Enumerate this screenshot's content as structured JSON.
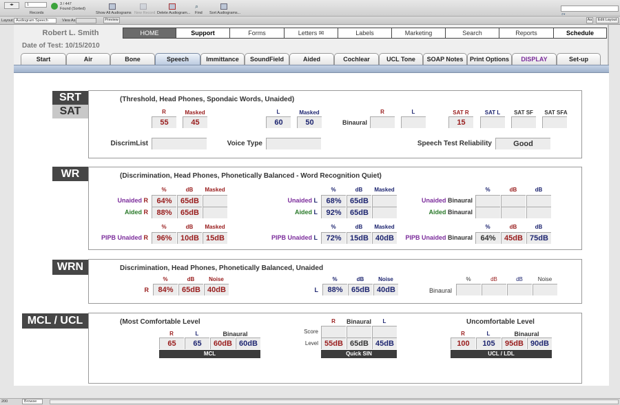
{
  "toolbar": {
    "record_number": "1",
    "records_label": "Records",
    "found_count": "3 / 447",
    "found_label": "Found (Sorted)",
    "show_all": "Show All Audiograms",
    "new_record": "New Record",
    "delete": "Delete Audiogram...",
    "find": "Find",
    "sort": "Sort Audiograms...",
    "search_placeholder": ""
  },
  "layout_bar": {
    "layout_label": "Layout:",
    "layout_value": "Audiogram Speech",
    "view_as": "View As:",
    "preview": "Preview",
    "aa": "Aа",
    "edit_layout": "Edit Layout"
  },
  "patient": {
    "name": "Robert L. Smith",
    "date": "Date of Test: 10/15/2010"
  },
  "nav": [
    "HOME",
    "Support",
    "Forms",
    "Letters",
    "Labels",
    "Marketing",
    "Search",
    "Reports",
    "Schedule"
  ],
  "tabs": [
    "Start",
    "Air",
    "Bone",
    "Speech",
    "Immittance",
    "SoundField",
    "Aided",
    "Cochlear",
    "UCL Tone",
    "SOAP Notes",
    "Print Options",
    "DISPLAY",
    "Set-up"
  ],
  "active_tab": "Speech",
  "colors": {
    "right": "#981b1b",
    "left": "#1d2570",
    "unaided": "#7b2c9b",
    "aided": "#2b7a2b",
    "active_nav": "#6b6b6b"
  },
  "srt": {
    "title1": "SRT",
    "title2": "SAT",
    "subtitle": "(Threshold, Head Phones, Spondaic Words, Unaided)",
    "h": {
      "r": "R",
      "masked": "Masked",
      "l": "L",
      "bin_r": "R",
      "bin_l": "L",
      "sat_r": "SAT R",
      "sat_l": "SAT L",
      "sat_sf": "SAT SF",
      "sat_sfa": "SAT SFA"
    },
    "v": {
      "r": "55",
      "r_masked": "45",
      "l": "60",
      "l_masked": "50",
      "bin_r": "",
      "bin_l": "",
      "sat_r": "15",
      "sat_l": "",
      "sat_sf": "",
      "sat_sfa": ""
    },
    "binaural": "Binaural",
    "discrim_label": "DiscrimList",
    "discrim": "",
    "voice_label": "Voice Type",
    "voice": "",
    "reliability_label": "Speech Test Reliability",
    "reliability": "Good"
  },
  "wr": {
    "title": "WR",
    "subtitle": "(Discrimination, Head Phones, Phonetically Balanced  -  Word Recognition Quiet)",
    "h": {
      "pct": "%",
      "db": "dB",
      "masked": "Masked"
    },
    "unaided": "Unaided",
    "aided": "Aided",
    "pipb": "PIPB Unaided",
    "r": "R",
    "l": "L",
    "binaural": "Binaural",
    "right": {
      "unaided": [
        "64%",
        "65dB",
        ""
      ],
      "aided": [
        "88%",
        "65dB",
        ""
      ],
      "pipb": [
        "96%",
        "10dB",
        "15dB"
      ]
    },
    "left": {
      "unaided": [
        "68%",
        "65dB",
        ""
      ],
      "aided": [
        "92%",
        "65dB",
        ""
      ],
      "pipb": [
        "72%",
        "15dB",
        "40dB"
      ]
    },
    "bin": {
      "unaided": [
        "",
        "",
        ""
      ],
      "aided": [
        "",
        "",
        ""
      ],
      "pipb": [
        "64%",
        "45dB",
        "75dB"
      ]
    }
  },
  "wrn": {
    "title": "WRN",
    "subtitle": "Discrimination, Head Phones, Phonetically Balanced, Unaided",
    "h": {
      "pct": "%",
      "db": "dB",
      "noise": "Noise"
    },
    "r": "R",
    "l": "L",
    "binaural": "Binaural",
    "right": [
      "84%",
      "65dB",
      "40dB"
    ],
    "left": [
      "88%",
      "65dB",
      "40dB"
    ],
    "bin": [
      "",
      "",
      "",
      ""
    ]
  },
  "mcl": {
    "title": "MCL / UCL",
    "subtitle": "(Most Comfortable Level",
    "h": {
      "r": "R",
      "l": "L",
      "binaural": "Binaural"
    },
    "mcl_values": [
      "65",
      "65",
      "60dB",
      "60dB"
    ],
    "mcl_bar": "MCL",
    "qs_score_label": "Score",
    "qs_level_label": "Level",
    "qs_score": [
      "",
      "",
      ""
    ],
    "qs_level": [
      "55dB",
      "65dB",
      "45dB"
    ],
    "qs_bar": "Quick SIN",
    "ucl_title": "Uncomfortable Level",
    "ucl_values": [
      "100",
      "105",
      "95dB",
      "90dB"
    ],
    "ucl_bar": "UCL / LDL"
  },
  "status": {
    "zoom": "200",
    "mode": "Browse"
  }
}
